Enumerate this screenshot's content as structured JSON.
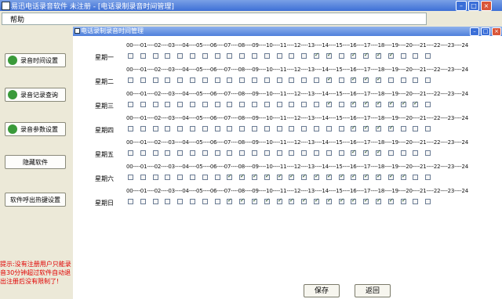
{
  "window": {
    "title": "易迅电话录音软件 未注册 - [电话录制录音时间管理]"
  },
  "menu": {
    "help_label": "帮助"
  },
  "sidebar": {
    "buttons": [
      {
        "label": "录音时间设置"
      },
      {
        "label": "录音记录查询"
      },
      {
        "label": "录音参数设置"
      },
      {
        "label": "隐藏软件"
      },
      {
        "label": "软件呼出热键设置"
      }
    ],
    "hint": "提示:没有注册用户只能录音30分钟超过软件自动退出注册后没有限制了!"
  },
  "panel": {
    "title": "电话录制录音时间管理",
    "hour_header": "00----01----02----03----04----05----06----07----08----09----10----11----12----13----14----15----16----17----18----19----20----21----22----23----24",
    "days": [
      {
        "label": "星期一",
        "checked": [
          0,
          0,
          0,
          0,
          0,
          0,
          0,
          0,
          0,
          0,
          0,
          0,
          0,
          0,
          0,
          1,
          1,
          0,
          1,
          1,
          1,
          1,
          0,
          0,
          0
        ]
      },
      {
        "label": "星期二",
        "checked": [
          0,
          0,
          0,
          0,
          0,
          0,
          0,
          0,
          0,
          0,
          0,
          0,
          0,
          0,
          0,
          0,
          1,
          0,
          1,
          1,
          1,
          0,
          0,
          0,
          0
        ]
      },
      {
        "label": "星期三",
        "checked": [
          0,
          0,
          0,
          0,
          0,
          0,
          0,
          0,
          0,
          0,
          0,
          0,
          0,
          0,
          0,
          0,
          1,
          0,
          1,
          1,
          1,
          1,
          1,
          1,
          0
        ]
      },
      {
        "label": "星期四",
        "checked": [
          0,
          0,
          0,
          0,
          0,
          0,
          0,
          0,
          0,
          0,
          0,
          0,
          0,
          0,
          0,
          0,
          0,
          0,
          1,
          1,
          1,
          1,
          0,
          0,
          0
        ]
      },
      {
        "label": "星期五",
        "checked": [
          0,
          0,
          0,
          0,
          0,
          0,
          0,
          0,
          0,
          0,
          0,
          0,
          0,
          0,
          0,
          0,
          0,
          0,
          1,
          1,
          1,
          0,
          0,
          0,
          0
        ]
      },
      {
        "label": "星期六",
        "checked": [
          0,
          0,
          0,
          0,
          0,
          0,
          0,
          0,
          1,
          1,
          1,
          1,
          1,
          1,
          1,
          1,
          1,
          1,
          1,
          1,
          1,
          1,
          1,
          0,
          0
        ]
      },
      {
        "label": "星期日",
        "checked": [
          0,
          0,
          0,
          0,
          0,
          0,
          0,
          0,
          1,
          1,
          1,
          1,
          1,
          1,
          1,
          1,
          1,
          1,
          1,
          1,
          1,
          1,
          1,
          0,
          0
        ]
      }
    ],
    "save_label": "保存",
    "back_label": "返回"
  }
}
